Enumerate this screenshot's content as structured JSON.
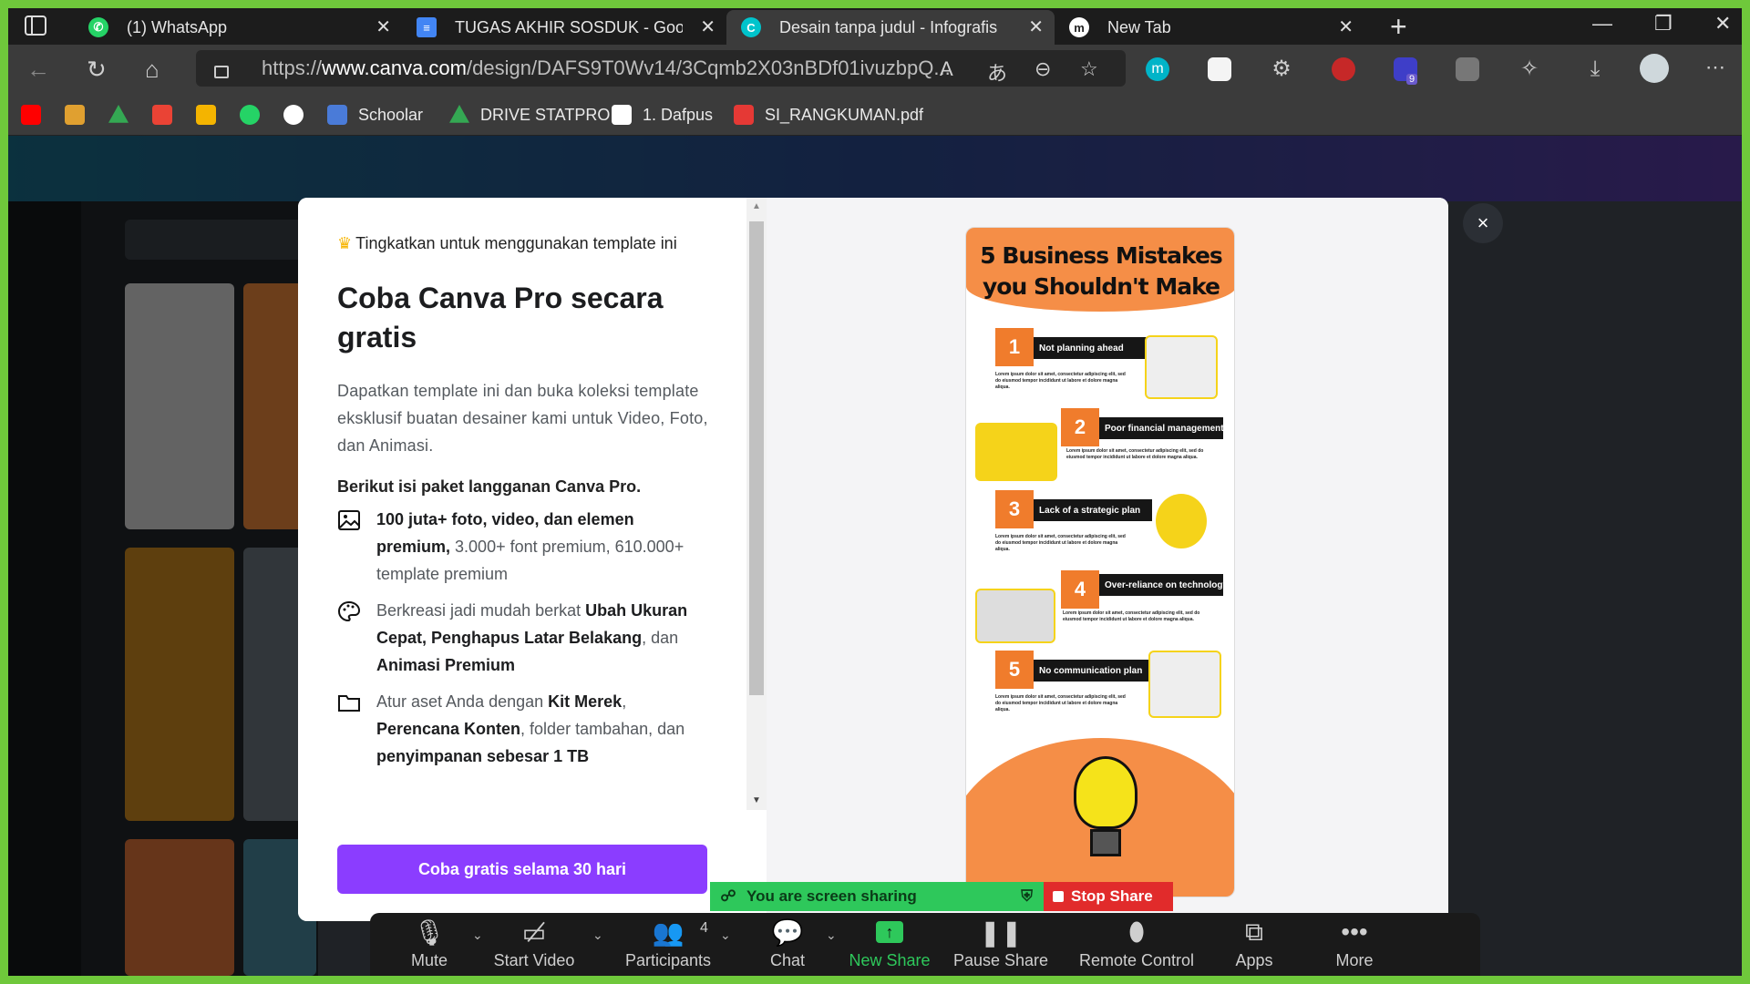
{
  "browser": {
    "tabs": [
      {
        "title": "(1) WhatsApp",
        "icon": "whatsapp-icon",
        "color": "#25d366"
      },
      {
        "title": "TUGAS AKHIR SOSDUK - Google",
        "icon": "google-docs-icon",
        "color": "#4285f4"
      },
      {
        "title": "Desain tanpa judul - Infografis",
        "icon": "canva-icon",
        "color": "#00c4cc"
      },
      {
        "title": "New Tab",
        "icon": "new-tab-icon",
        "color": "#ffffff"
      }
    ],
    "url": {
      "prefix": "https://",
      "domain": "www.canva.com",
      "path": "/design/DAFS9T0Wv14/3Cqmb2X03nBDf01ivuzbpQ..."
    },
    "bookmarks": [
      {
        "label": "",
        "icon": "youtube-icon",
        "color": "#ff0000"
      },
      {
        "label": "",
        "icon": "logo-icon",
        "color": "#e0a030"
      },
      {
        "label": "",
        "icon": "google-drive-icon",
        "color": "#34a853"
      },
      {
        "label": "",
        "icon": "gmail-icon",
        "color": "#ea4335"
      },
      {
        "label": "",
        "icon": "google-classroom-icon",
        "color": "#f4b400"
      },
      {
        "label": "",
        "icon": "whatsapp-icon",
        "color": "#25d366"
      },
      {
        "label": "",
        "icon": "github-icon",
        "color": "#ffffff"
      },
      {
        "label": "Schoolar",
        "icon": "schoolar-icon",
        "color": "#4a7bd8"
      },
      {
        "label": "DRIVE STATPRO",
        "icon": "google-drive-icon",
        "color": "#34a853"
      },
      {
        "label": "1. Dafpus",
        "icon": "pkp-icon",
        "color": "#ffffff"
      },
      {
        "label": "SI_RANGKUMAN.pdf",
        "icon": "pdf-icon",
        "color": "#e53935"
      }
    ],
    "download_badge": "9"
  },
  "modal": {
    "upgrade_note": "Tingkatkan untuk menggunakan template ini",
    "title": "Coba Canva Pro secara gratis",
    "description": "Dapatkan template ini dan buka koleksi template eksklusif buatan desainer kami untuk Video, Foto, dan Animasi.",
    "package_heading": "Berikut isi paket langganan Canva Pro.",
    "features": [
      {
        "icon": "image-icon",
        "bold1": "100 juta+ foto, video, dan elemen premium,",
        "text1": " 3.000+ font premium, 610.000+ template premium"
      },
      {
        "icon": "palette-icon",
        "text0": "Berkreasi jadi mudah berkat ",
        "bold1": "Ubah Ukuran Cepat, Penghapus Latar Belakang",
        "text1": ", dan ",
        "bold2": "Animasi Premium"
      },
      {
        "icon": "folder-icon",
        "text0": "Atur aset Anda dengan ",
        "bold1": "Kit Merek",
        "text1": ", ",
        "bold2": "Perencana Konten",
        "text2": ", folder tambahan, dan ",
        "bold3": "penyimpanan sebesar 1 TB"
      }
    ],
    "cta": "Coba gratis selama 30 hari",
    "close": "×"
  },
  "infographic": {
    "title": "5 Business Mistakes you Shouldn't Make",
    "items": [
      {
        "num": "1",
        "label": "Not planning ahead"
      },
      {
        "num": "2",
        "label": "Poor financial management"
      },
      {
        "num": "3",
        "label": "Lack of a strategic plan"
      },
      {
        "num": "4",
        "label": "Over-reliance on technology"
      },
      {
        "num": "5",
        "label": "No communication plan"
      }
    ],
    "lorem": "Lorem ipsum dolor sit amet, consectetur adipiscing elit, sed do eiusmod tempor incididunt ut labore et dolore magna aliqua."
  },
  "zoom": {
    "sharing_text": "You are screen sharing",
    "stop_share": "Stop Share",
    "buttons": [
      {
        "label": "Mute",
        "icon": "microphone-icon"
      },
      {
        "label": "Start Video",
        "icon": "video-off-icon"
      },
      {
        "label": "Participants",
        "icon": "participants-icon",
        "count": "4"
      },
      {
        "label": "Chat",
        "icon": "chat-icon"
      },
      {
        "label": "New Share",
        "icon": "share-arrow-icon"
      },
      {
        "label": "Pause Share",
        "icon": "pause-icon"
      },
      {
        "label": "Remote Control",
        "icon": "mouse-icon"
      },
      {
        "label": "Apps",
        "icon": "apps-icon"
      },
      {
        "label": "More",
        "icon": "more-icon"
      }
    ],
    "colors": {
      "green": "#2ec85b",
      "red": "#e12b2b",
      "frame": "#6fc83b"
    }
  }
}
